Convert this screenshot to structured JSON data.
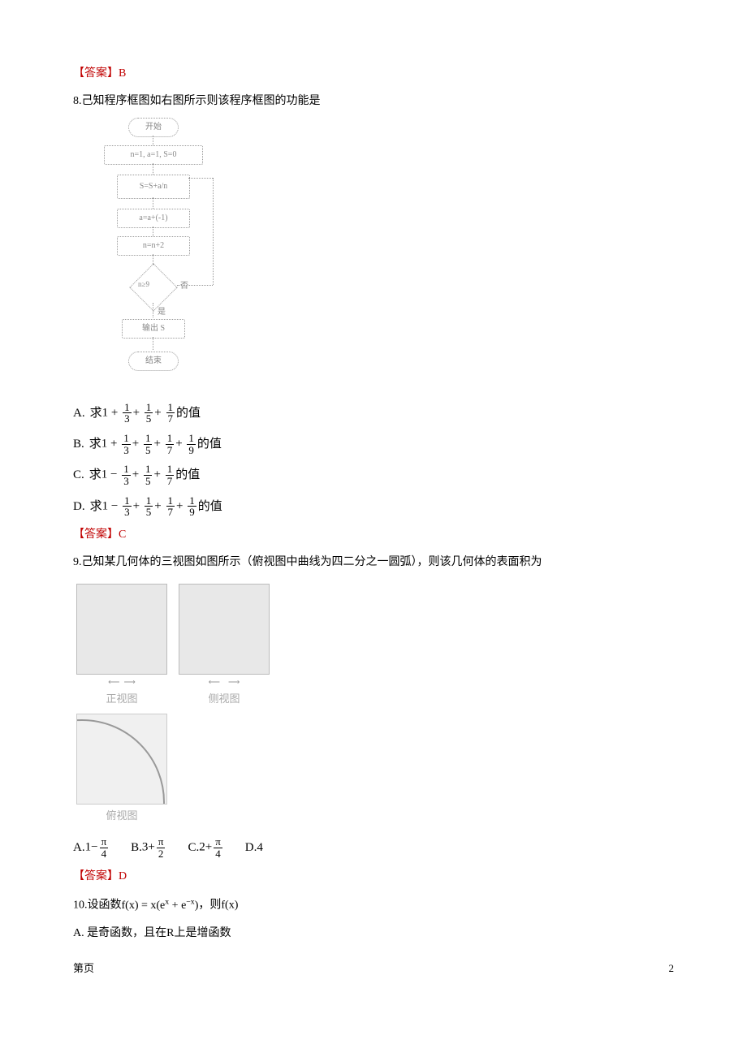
{
  "q7": {
    "answer_label": "【答案】",
    "answer_letter": "B"
  },
  "q8": {
    "number": "8.",
    "text": "己知程序框图如右图所示则该程序框图的功能是",
    "flow": {
      "start": "开始",
      "init": "n=1, a=1, S=0",
      "step1": "S=S+a/n",
      "step2": "a=a+(-1)",
      "step3": "n=n+2",
      "cond": "n≥9",
      "yes": "是",
      "no": "否",
      "out": "输出 S",
      "end": "结束"
    },
    "options": {
      "A": {
        "lead": "A. ",
        "pre": "求",
        "expr_type": "plus4",
        "tail": "的值"
      },
      "B": {
        "lead": "B. ",
        "pre": "求",
        "expr_type": "plus5",
        "tail": "的值"
      },
      "C": {
        "lead": "C. ",
        "pre": "求",
        "expr_type": "alt4",
        "tail": "的值"
      },
      "D": {
        "lead": "D. ",
        "pre": "求",
        "expr_type": "alt5",
        "tail": "的值"
      }
    },
    "answer_label": "【答案】",
    "answer_letter": "C"
  },
  "q9": {
    "number": "9.",
    "text": "己知某几何体的三视图如图所示（俯视图中曲线为四二分之一圆弧），则该几何体的表面积为",
    "labels": {
      "front": "正视图",
      "side": "侧视图",
      "top": "俯视图"
    },
    "options": {
      "A": {
        "lead": "A. ",
        "base": "1",
        "op": "−",
        "pi_over": "4"
      },
      "B": {
        "lead": "B. ",
        "base": "3",
        "op": "+",
        "pi_over": "2"
      },
      "C": {
        "lead": "C. ",
        "base": "2",
        "op": "+",
        "pi_over": "4"
      },
      "D": {
        "lead": "D. ",
        "plain": "4"
      }
    },
    "answer_label": "【答案】",
    "answer_letter": "D"
  },
  "q10": {
    "number": "10.",
    "text_prefix": "设函数",
    "formula": "f(x) = x(eˣ + e⁻ˣ)",
    "text_suffix": "，则f(x)",
    "optA": {
      "lead": "A. ",
      "text": "是奇函数，且在R上是增函数"
    }
  },
  "footer": {
    "left": "第页",
    "right": "2"
  }
}
